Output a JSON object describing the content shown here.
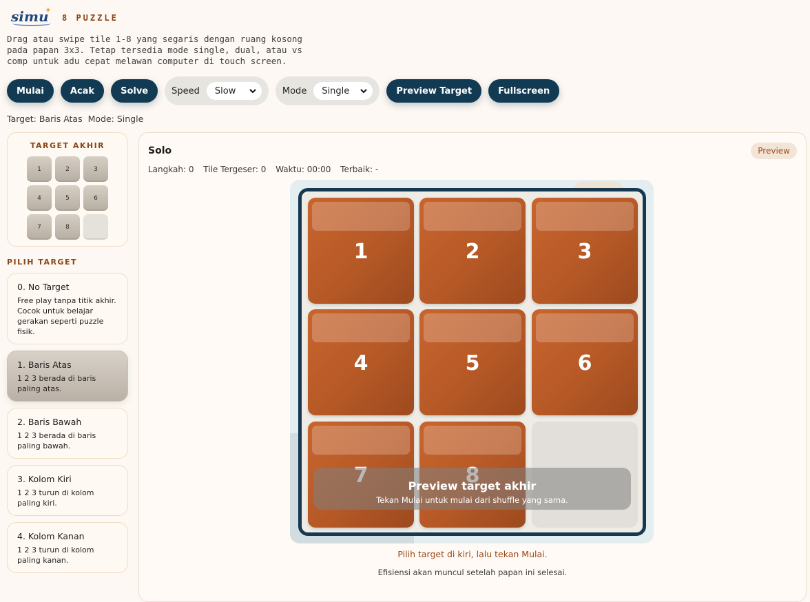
{
  "header": {
    "logo": "simu",
    "title": "8 PUZZLE"
  },
  "description": "Drag atau swipe tile 1-8 yang segaris dengan ruang kosong pada papan 3x3. Tetap tersedia mode single, dual, atau vs comp untuk adu cepat melawan computer di touch screen.",
  "toolbar": {
    "start": "Mulai",
    "shuffle": "Acak",
    "solve": "Solve",
    "speed_label": "Speed",
    "speed_value": "Slow",
    "mode_label": "Mode",
    "mode_value": "Single",
    "preview_target": "Preview Target",
    "fullscreen": "Fullscreen"
  },
  "status": {
    "target": "Target: Baris Atas",
    "mode": "Mode: Single"
  },
  "target_preview": {
    "title": "TARGET AKHIR",
    "tiles": [
      "1",
      "2",
      "3",
      "4",
      "5",
      "6",
      "7",
      "8",
      ""
    ]
  },
  "target_list": {
    "title": "PILIH TARGET",
    "items": [
      {
        "title": "0. No Target",
        "desc": "Free play tanpa titik akhir. Cocok untuk belajar gerakan seperti puzzle fisik."
      },
      {
        "title": "1. Baris Atas",
        "desc": "1 2 3 berada di baris paling atas."
      },
      {
        "title": "2. Baris Bawah",
        "desc": "1 2 3 berada di baris paling bawah."
      },
      {
        "title": "3. Kolom Kiri",
        "desc": "1 2 3 turun di kolom paling kiri."
      },
      {
        "title": "4. Kolom Kanan",
        "desc": "1 2 3 turun di kolom paling kanan."
      }
    ],
    "selected_index": 1
  },
  "panel": {
    "title": "Solo",
    "badge": "Preview",
    "stats": {
      "moves": "Langkah: 0",
      "shifted": "Tile Tergeser: 0",
      "time": "Waktu: 00:00",
      "best": "Terbaik: -"
    },
    "board": [
      "1",
      "2",
      "3",
      "4",
      "5",
      "6",
      "7",
      "8",
      ""
    ],
    "overlay": {
      "title": "Preview target akhir",
      "subtitle": "Tekan Mulai untuk mulai dari shuffle yang sama."
    },
    "hint": "Pilih target di kiri, lalu tekan Mulai.",
    "efficiency": "Efisiensi akan muncul setelah papan ini selesai."
  },
  "colors": {
    "primary": "#123a52",
    "accent": "#8a4514",
    "tile": "#b85a27",
    "background": "#fdf8f3"
  }
}
